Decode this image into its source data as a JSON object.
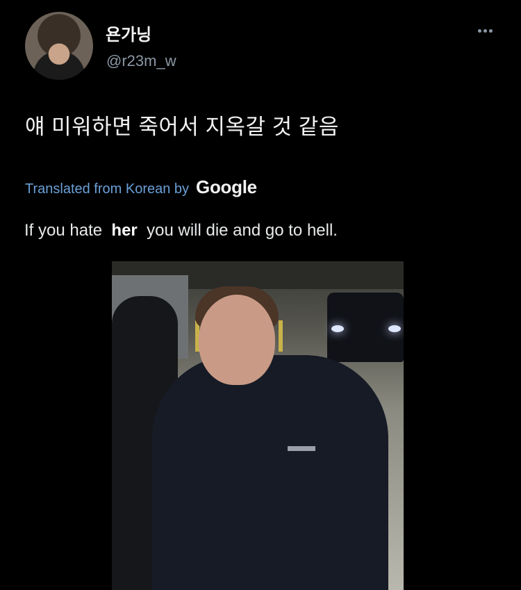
{
  "tweet": {
    "author": {
      "display_name": "욘가닝",
      "handle": "@r23m_w",
      "avatar_icon": "user-avatar"
    },
    "text": "얘 미워하면 죽어서 지옥갈 것 같음",
    "translation": {
      "label": "Translated from Korean by",
      "provider": "Google",
      "text_before": "If you hate",
      "text_emphasis": "her",
      "text_after": "you will die and go to hell."
    },
    "more_icon": "more-horizontal-icon",
    "label_color": "#6aa0d8"
  }
}
